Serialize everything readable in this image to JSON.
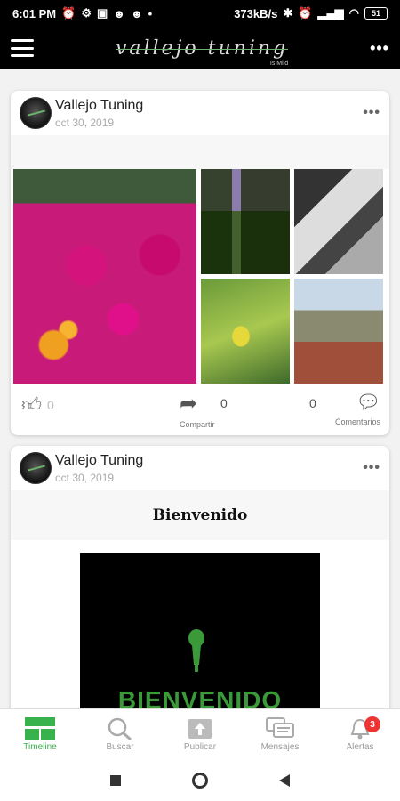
{
  "status_bar": {
    "time": "6:01 PM",
    "speed": "373kB/s",
    "battery": "51"
  },
  "app_bar": {
    "logo_text": "vallejo tuning",
    "logo_sub": "Is Mild"
  },
  "posts": [
    {
      "author": "Vallejo Tuning",
      "date": "oct 30, 2019",
      "likes": "0",
      "shares": "0",
      "share_label": "Compartir",
      "comments": "0",
      "comments_label": "Comentarios"
    },
    {
      "author": "Vallejo Tuning",
      "date": "oct 30, 2019",
      "title": "Bienvenido",
      "image_text": "BIENVENIDO"
    }
  ],
  "bottom_nav": {
    "items": [
      {
        "label": "Timeline",
        "icon": "timeline-icon"
      },
      {
        "label": "Buscar",
        "icon": "search-icon"
      },
      {
        "label": "Publicar",
        "icon": "upload-icon"
      },
      {
        "label": "Mensajes",
        "icon": "messages-icon"
      },
      {
        "label": "Alertas",
        "icon": "bell-icon",
        "badge": "3"
      }
    ],
    "active_color": "#37b24d"
  }
}
